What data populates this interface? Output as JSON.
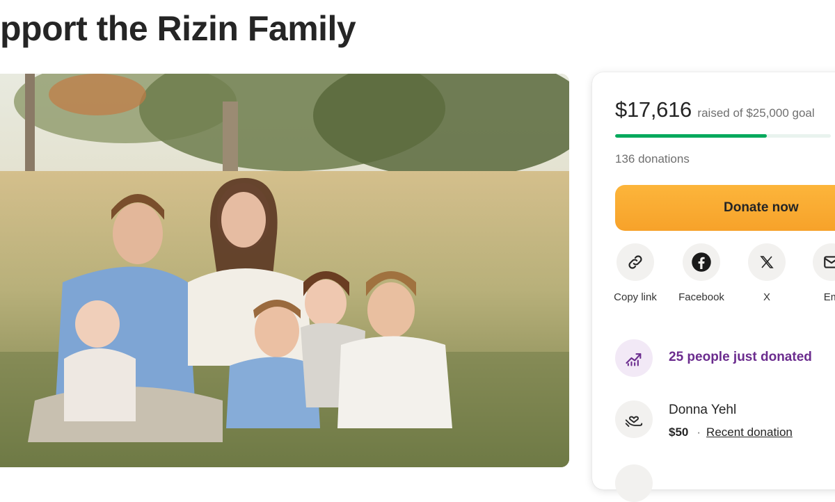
{
  "campaign": {
    "title": "pport the Rizin Family"
  },
  "photo": {
    "icon": "family-photo"
  },
  "donation_card": {
    "amount_raised": "$17,616",
    "goal_text": "raised of $25,000 goal",
    "progress_fraction": 0.7046,
    "donations_count": "136 donations",
    "donate_button_label": "Donate now",
    "accent_color": "#02a95c",
    "button_color": "#f9a932",
    "share": [
      {
        "label": "Copy link",
        "icon": "link-icon"
      },
      {
        "label": "Facebook",
        "icon": "facebook-icon"
      },
      {
        "label": "X",
        "icon": "x-icon"
      },
      {
        "label": "Em",
        "icon": "email-icon"
      }
    ],
    "recent_activity": {
      "text": "25 people just donated",
      "icon": "trending-up-icon",
      "color": "#6b2c8e"
    },
    "latest_donation": {
      "name": "Donna Yehl",
      "amount": "$50",
      "separator": "·",
      "tag": "Recent donation",
      "icon": "heart-hands-icon"
    }
  }
}
